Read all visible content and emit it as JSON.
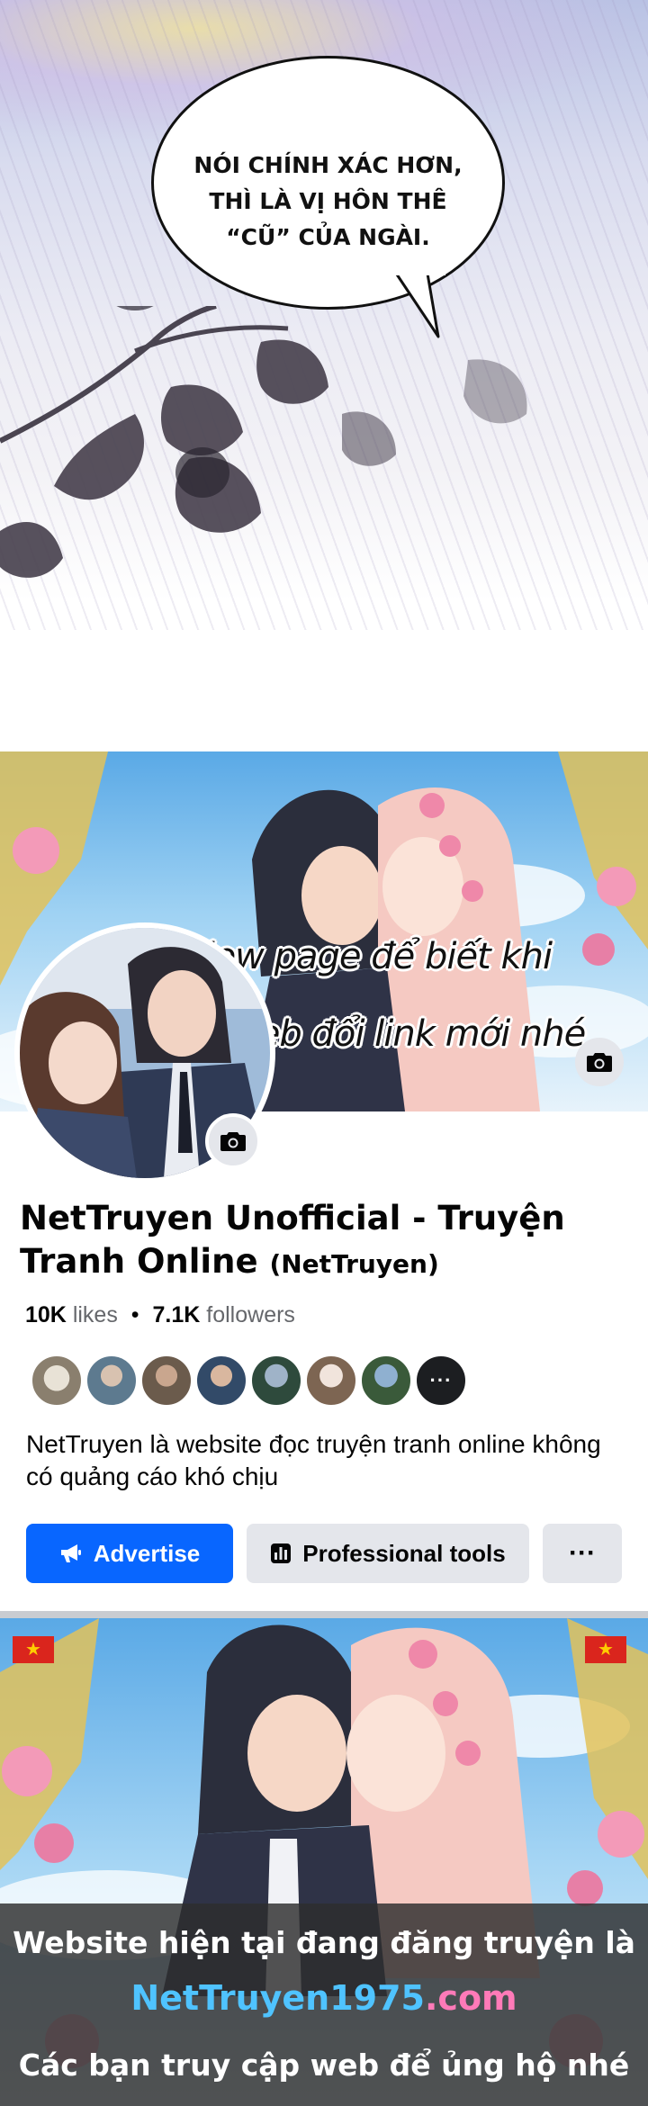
{
  "comic": {
    "speech_lines": [
      "NÓI CHÍNH XÁC HƠN,",
      "THÌ LÀ VỊ HÔN THÊ",
      "“CŨ” CỦA NGÀI."
    ]
  },
  "fb_page": {
    "cover_text": [
      "Follow page để biết khi",
      "nào web đổi link mới nhé"
    ],
    "title": "NetTruyen Unofficial - Truyện Tranh Online",
    "handle": "(NetTruyen)",
    "likes_count": "10K",
    "likes_label": "likes",
    "separator": "•",
    "followers_count": "7.1K",
    "followers_label": "followers",
    "friends_more": "···",
    "description": "NetTruyen là website đọc truyện tranh online không có quảng cáo khó chịu",
    "buttons": {
      "advertise": "Advertise",
      "professional_tools": "Professional tools",
      "more": "···"
    },
    "colors": {
      "primary": "#0866ff",
      "secondary_bg": "#e4e6eb",
      "muted_text": "#65676b"
    },
    "icons": [
      "camera-icon",
      "megaphone-icon",
      "chart-icon",
      "more-icon"
    ]
  },
  "banner": {
    "flag_star": "★",
    "line1": "Website hiện tại đang đăng truyện là",
    "site_part1": "NetTruyen1975",
    "site_part2": ".com",
    "line3": "Các bạn truy cập web để ủng hộ nhé"
  }
}
